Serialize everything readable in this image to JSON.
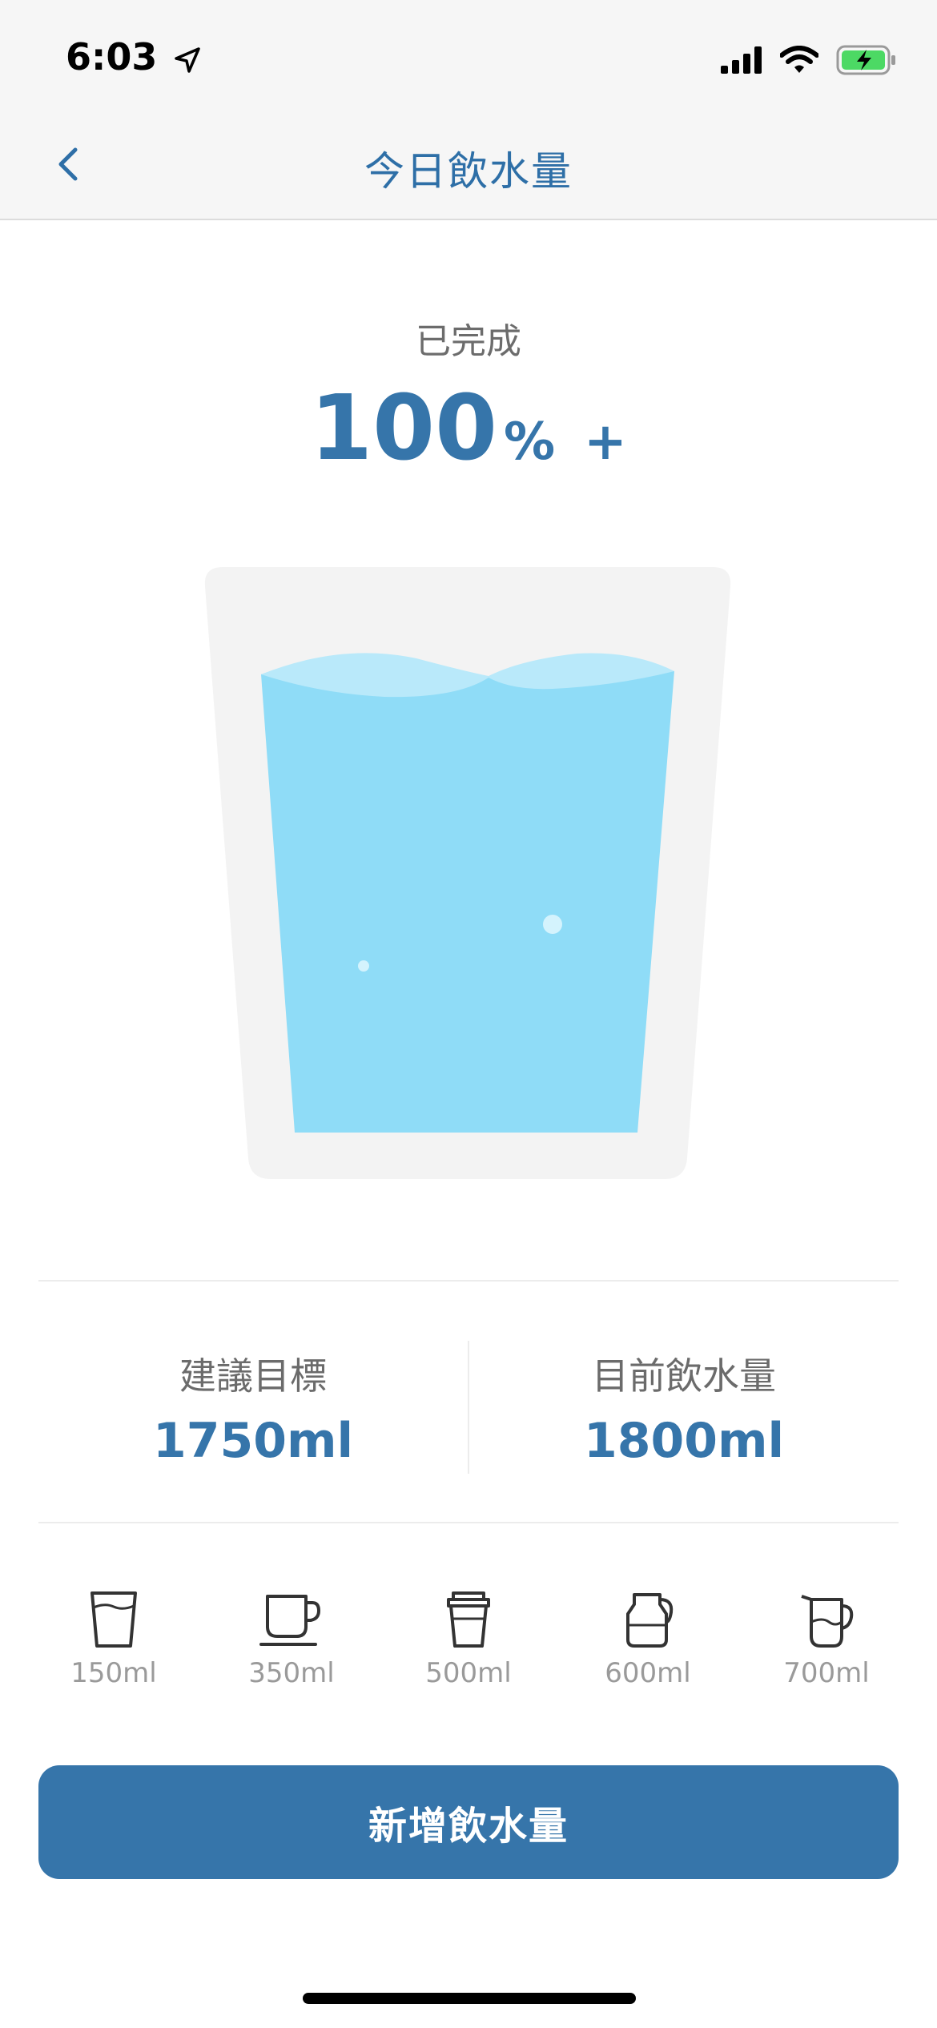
{
  "status_bar": {
    "time": "6:03"
  },
  "nav": {
    "title": "今日飲水量"
  },
  "progress": {
    "label": "已完成",
    "value": "100",
    "unit": "%",
    "plus": "+"
  },
  "glass": {
    "fill_fraction": 0.88,
    "water_color": "#8fdcf7",
    "glass_color": "#f3f3f3"
  },
  "stats": {
    "goal": {
      "label": "建議目標",
      "value": "1750ml"
    },
    "current": {
      "label": "目前飲水量",
      "value": "1800ml"
    }
  },
  "cups": [
    {
      "icon": "glass-icon",
      "label": "150ml"
    },
    {
      "icon": "mug-icon",
      "label": "350ml"
    },
    {
      "icon": "takeaway-cup-icon",
      "label": "500ml"
    },
    {
      "icon": "carafe-icon",
      "label": "600ml"
    },
    {
      "icon": "pitcher-icon",
      "label": "700ml"
    }
  ],
  "add_button": {
    "label": "新增飲水量"
  },
  "colors": {
    "accent": "#3675aa",
    "water": "#8fdcf7"
  }
}
